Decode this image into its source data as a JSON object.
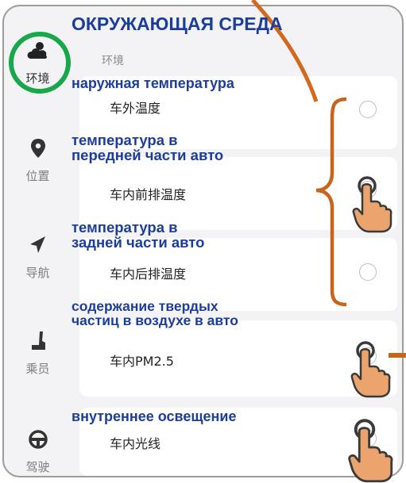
{
  "annotation_title": "ОКРУЖАЮЩАЯ СРЕДА",
  "sidebar": {
    "items": [
      {
        "icon": "weather-cloud-icon",
        "label": "环境",
        "active": true
      },
      {
        "icon": "location-pin-icon",
        "label": "位置",
        "active": false
      },
      {
        "icon": "navigation-arrow-icon",
        "label": "导航",
        "active": false
      },
      {
        "icon": "passenger-seat-icon",
        "label": "乘员",
        "active": false
      },
      {
        "icon": "steering-wheel-icon",
        "label": "驾驶",
        "active": false
      }
    ]
  },
  "main": {
    "section_title": "环境",
    "options": [
      {
        "label": "车外温度",
        "annotation_lines": [
          "наружная температура"
        ]
      },
      {
        "label": "车内前排温度",
        "annotation_lines": [
          "температура в",
          "передней части авто"
        ]
      },
      {
        "label": "车内后排温度",
        "annotation_lines": [
          "температура в",
          "задней части авто"
        ]
      },
      {
        "label": "车内PM2.5",
        "annotation_lines": [
          "содержание твердых",
          "частиц в воздухе в авто"
        ]
      },
      {
        "label": "车内光线",
        "annotation_lines": [
          "внутреннее освещение"
        ]
      }
    ]
  },
  "colors": {
    "annotation_text": "#1c3e9a",
    "highlight_ring": "#16a84a",
    "bracket_and_arrow": "#c8641c",
    "hand_fill": "#eba46e"
  }
}
